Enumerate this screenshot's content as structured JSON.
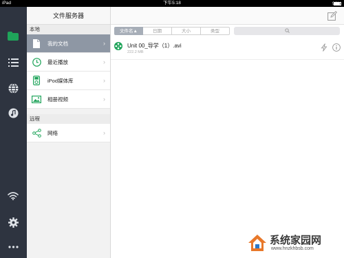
{
  "status_bar": {
    "device": "iPad",
    "time": "下午5:18",
    "battery": "96%"
  },
  "rail": {
    "items": [
      {
        "icon": "folder-icon",
        "active": true
      },
      {
        "icon": "list-icon"
      },
      {
        "icon": "globe-icon"
      },
      {
        "icon": "music-icon"
      },
      {
        "icon": "wifi-icon"
      },
      {
        "icon": "gear-icon"
      },
      {
        "icon": "more-icon"
      }
    ]
  },
  "panel": {
    "title": "文件服务器",
    "sections": {
      "local": "本地",
      "remote": "远程"
    },
    "items": [
      {
        "label": "我的文档",
        "icon": "document-icon",
        "active": true
      },
      {
        "label": "最近播放",
        "icon": "clock-icon"
      },
      {
        "label": "iPod媒体库",
        "icon": "ipod-icon"
      },
      {
        "label": "相册视频",
        "icon": "photo-video-icon"
      },
      {
        "label": "网络",
        "icon": "share-network-icon"
      }
    ],
    "chevron": "›"
  },
  "main": {
    "sort_tabs": [
      {
        "label": "文件名▲",
        "active": true
      },
      {
        "label": "日期"
      },
      {
        "label": "大小"
      },
      {
        "label": "类型"
      }
    ],
    "search_icon": "search-icon",
    "files": [
      {
        "name": "Unit 00_导学（1）.avi",
        "size": "222.2 MB",
        "icon": "film-reel-icon"
      }
    ]
  },
  "watermark": {
    "text": "系统家园网",
    "url": "www.hnzkhbsb.com"
  },
  "colors": {
    "accent_green": "#1fa45a",
    "rail_bg": "#2e3440",
    "active_item_bg": "#8e97a4"
  }
}
